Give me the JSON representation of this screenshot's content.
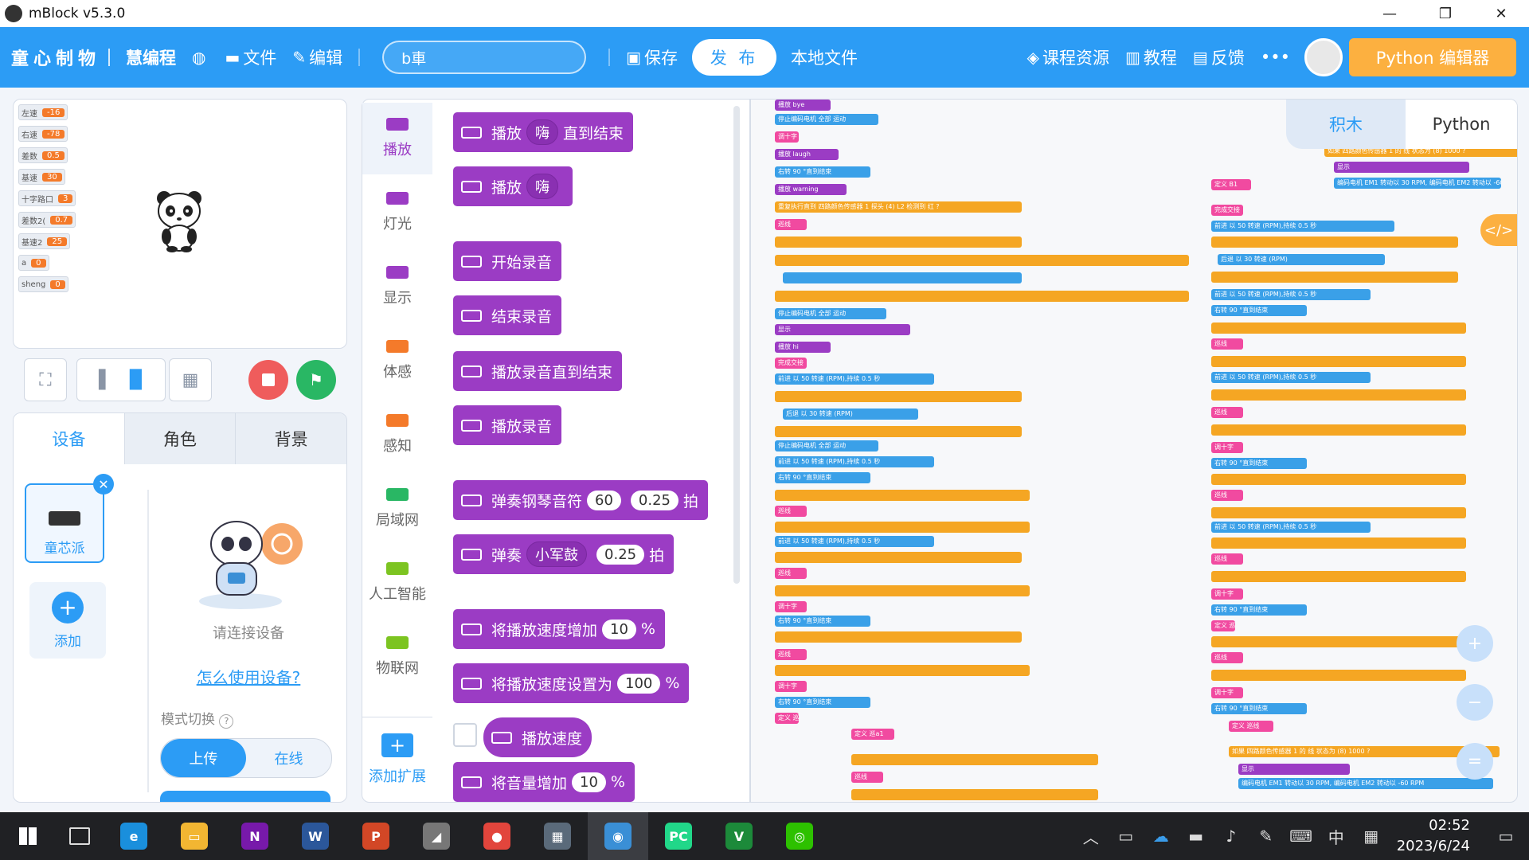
{
  "window": {
    "title": "mBlock v5.3.0",
    "minimize": "—",
    "maximize": "❐",
    "close": "✕"
  },
  "menubar": {
    "brand": "童心制物",
    "product": "慧编程",
    "file": "文件",
    "edit": "编辑",
    "project_name": "b車",
    "save": "保存",
    "publish": "发 布",
    "local_file": "本地文件",
    "course": "课程资源",
    "tutorial": "教程",
    "feedback": "反馈",
    "more": "•••",
    "python_editor": "Python 编辑器"
  },
  "variables": [
    {
      "name": "左速",
      "value": "-16"
    },
    {
      "name": "右速",
      "value": "-78"
    },
    {
      "name": "差数",
      "value": "0.5"
    },
    {
      "name": "基速",
      "value": "30"
    },
    {
      "name": "十字路口",
      "value": "3"
    },
    {
      "name": "差数2(",
      "value": "0.7"
    },
    {
      "name": "基速2",
      "value": "25"
    },
    {
      "name": "a",
      "value": "0"
    },
    {
      "name": "sheng",
      "value": "0"
    }
  ],
  "device_panel": {
    "tabs": [
      "设备",
      "角色",
      "背景"
    ],
    "device_name": "童芯派",
    "add": "添加",
    "connect_hint": "请连接设备",
    "how_to": "怎么使用设备?",
    "mode_switch": "模式切换",
    "mode_upload": "上传",
    "mode_online": "在线"
  },
  "categories": [
    {
      "label": "播放",
      "color": "#9b3cc4"
    },
    {
      "label": "灯光",
      "color": "#9b3cc4"
    },
    {
      "label": "显示",
      "color": "#9b3cc4"
    },
    {
      "label": "体感",
      "color": "#f47a2a"
    },
    {
      "label": "感知",
      "color": "#f47a2a"
    },
    {
      "label": "局域网",
      "color": "#29b764"
    },
    {
      "label": "人工智能",
      "color": "#7cc421"
    },
    {
      "label": "物联网",
      "color": "#7cc421"
    }
  ],
  "add_extension": "添加扩展",
  "blocks": {
    "b1": {
      "a": "播放",
      "dd": "嗨",
      "b": "直到结束"
    },
    "b2": {
      "a": "播放",
      "dd": "嗨"
    },
    "b3": "开始录音",
    "b4": "结束录音",
    "b5": "播放录音直到结束",
    "b6": "播放录音",
    "b7": {
      "a": "弹奏钢琴音符",
      "v1": "60",
      "v2": "0.25",
      "b": "拍"
    },
    "b8": {
      "a": "弹奏",
      "dd": "小军鼓",
      "v": "0.25",
      "b": "拍"
    },
    "b9": {
      "a": "将播放速度增加",
      "v": "10",
      "b": "%"
    },
    "b10": {
      "a": "将播放速度设置为",
      "v": "100",
      "b": "%"
    },
    "b11": "播放速度",
    "b12": {
      "a": "将音量增加",
      "v": "10",
      "b": "%"
    }
  },
  "script_tabs": {
    "blocks": "积木",
    "python": "Python"
  },
  "code_toggle": "</>",
  "script_snippets": {
    "s1": "播放 bye",
    "s2": "停止编码电机 全部 运动",
    "s3": "调十字",
    "s4": "播放 laugh",
    "s5": "右转 90 °直到结束",
    "s6": "播放 warning",
    "s7": "重复执行直到 四路颜色传感器 1 探头 (4) L2 检测到 红 ?",
    "s8": "巡线",
    "s9": "定义 B1",
    "s10": "完成交接",
    "s11": "前进 以 50 转速 (RPM),持续 0.5 秒",
    "s12": "定义 巡a1",
    "s13": "定义 巡线",
    "s14": "如果 四路颜色传感器 1 的 线 状态为 (8) 1000 ?",
    "s15": "编码电机 EM1 转动以 30 RPM, 编码电机 EM2 转动以 -60 RPM",
    "s16": "显示",
    "s17": "播放 hi",
    "s18": "后退 以 30 转速 (RPM)"
  },
  "zoom": {
    "in": "+",
    "out": "−",
    "reset": "="
  },
  "taskbar": {
    "time": "02:52",
    "date": "2023/6/24",
    "ime": "中",
    "apps": [
      {
        "name": "edge",
        "color": "#1a8fdc",
        "glyph": "e"
      },
      {
        "name": "explorer",
        "color": "#f2b632",
        "glyph": "▭"
      },
      {
        "name": "onenote",
        "color": "#7719aa",
        "glyph": "N"
      },
      {
        "name": "word",
        "color": "#2b579a",
        "glyph": "W"
      },
      {
        "name": "powerpoint",
        "color": "#d24726",
        "glyph": "P"
      },
      {
        "name": "drive",
        "color": "#777777",
        "glyph": "◢"
      },
      {
        "name": "chrome",
        "color": "#e2453c",
        "glyph": "●"
      },
      {
        "name": "calculator",
        "color": "#5a6a7a",
        "glyph": "▦"
      },
      {
        "name": "mblock",
        "color": "#3a8fd6",
        "glyph": "◉"
      },
      {
        "name": "pycharm",
        "color": "#21d789",
        "glyph": "PC"
      },
      {
        "name": "vim",
        "color": "#1c8a3a",
        "glyph": "V"
      },
      {
        "name": "wechat",
        "color": "#2dc100",
        "glyph": "◎"
      }
    ]
  }
}
